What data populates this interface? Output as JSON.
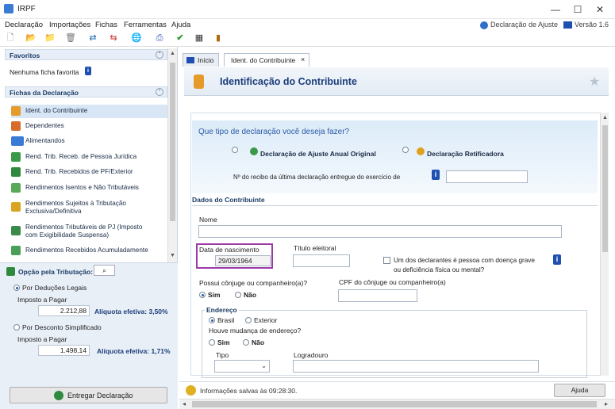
{
  "window": {
    "title": "IRPF",
    "minimize": "—",
    "maximize": "☐",
    "close": "✕"
  },
  "menu": {
    "items": [
      "Declaração",
      "Importações",
      "Fichas",
      "Ferramentas",
      "Ajuda"
    ],
    "declaracao_ajuste": "Declaração de Ajuste",
    "versao": "Versão 1.6"
  },
  "sidebar": {
    "favoritos_title": "Favoritos",
    "nenhuma_favorita": "Nenhuma ficha favorita",
    "fichas_title": "Fichas da Declaração",
    "items": [
      {
        "label": "Ident. do Contribuinte",
        "icon": "person-icon"
      },
      {
        "label": "Dependentes",
        "icon": "dependents-icon"
      },
      {
        "label": "Alimentandos",
        "icon": "family-icon"
      },
      {
        "label": "Rend. Trib. Receb. de Pessoa Jurídica",
        "icon": "money-plus-icon"
      },
      {
        "label": "Rend. Trib. Recebidos de PF/Exterior",
        "icon": "money-globe-icon"
      },
      {
        "label": "Rendimentos Isentos e Não Tributáveis",
        "icon": "exempt-icon"
      },
      {
        "label": "Rendimentos Sujeitos à Tributação",
        "label2": "Exclusiva/Definitiva",
        "icon": "taxed-icon"
      },
      {
        "label": "Rendimentos Tributáveis de PJ (Imposto",
        "label2": "com Exigibilidade Suspensa)",
        "icon": "suspended-icon"
      },
      {
        "label": "Rendimentos Recebidos Acumuladamente",
        "icon": "accumulated-icon"
      }
    ]
  },
  "tributacao": {
    "title": "Opção pela Tributação:",
    "legais": {
      "label": "Por Deduções Legais",
      "imposto_label": "Imposto a Pagar",
      "valor": "2.212,88",
      "aliquota": "Alíquota efetiva: 3,50%"
    },
    "simplificado": {
      "label": "Por Desconto Simplificado",
      "imposto_label": "Imposto a Pagar",
      "valor": "1.498,14",
      "aliquota": "Alíquota efetiva: 1,71%"
    },
    "entregar": "Entregar Declaração"
  },
  "tabs": [
    {
      "label": "Início"
    },
    {
      "label": "Ident. do Contribuinte",
      "close": "×"
    }
  ],
  "header": {
    "title": "Identificação do Contribuinte"
  },
  "form": {
    "question": "Que tipo de declaração você deseja fazer?",
    "tipo_original": "Declaração de Ajuste Anual Original",
    "tipo_retificadora": "Declaração Retificadora",
    "recibo_label": "Nº do recibo da última declaração entregue do exercício de",
    "dados_title": "Dados do Contribuinte",
    "nome_label": "Nome",
    "nome_value": "",
    "nasc_label": "Data de nascimento",
    "nasc_value": "29/03/1964",
    "titulo_label": "Título eleitoral",
    "doenca_label": "Um dos declarantes é pessoa com doença grave",
    "doenca_label2": "ou deficiência física ou mental?",
    "conjuge_q": "Possui cônjuge ou companheiro(a)?",
    "sim": "Sim",
    "nao": "Não",
    "cpf_conjuge_label": "CPF do cônjuge ou companheiro(a)",
    "endereco_title": "Endereço",
    "brasil": "Brasil",
    "exterior": "Exterior",
    "mudanca_q": "Houve mudança de endereço?",
    "tipo_label": "Tipo",
    "logradouro_label": "Logradouro"
  },
  "status": {
    "text": "Informações salvas às 09:28:30.",
    "ajuda": "Ajuda"
  }
}
